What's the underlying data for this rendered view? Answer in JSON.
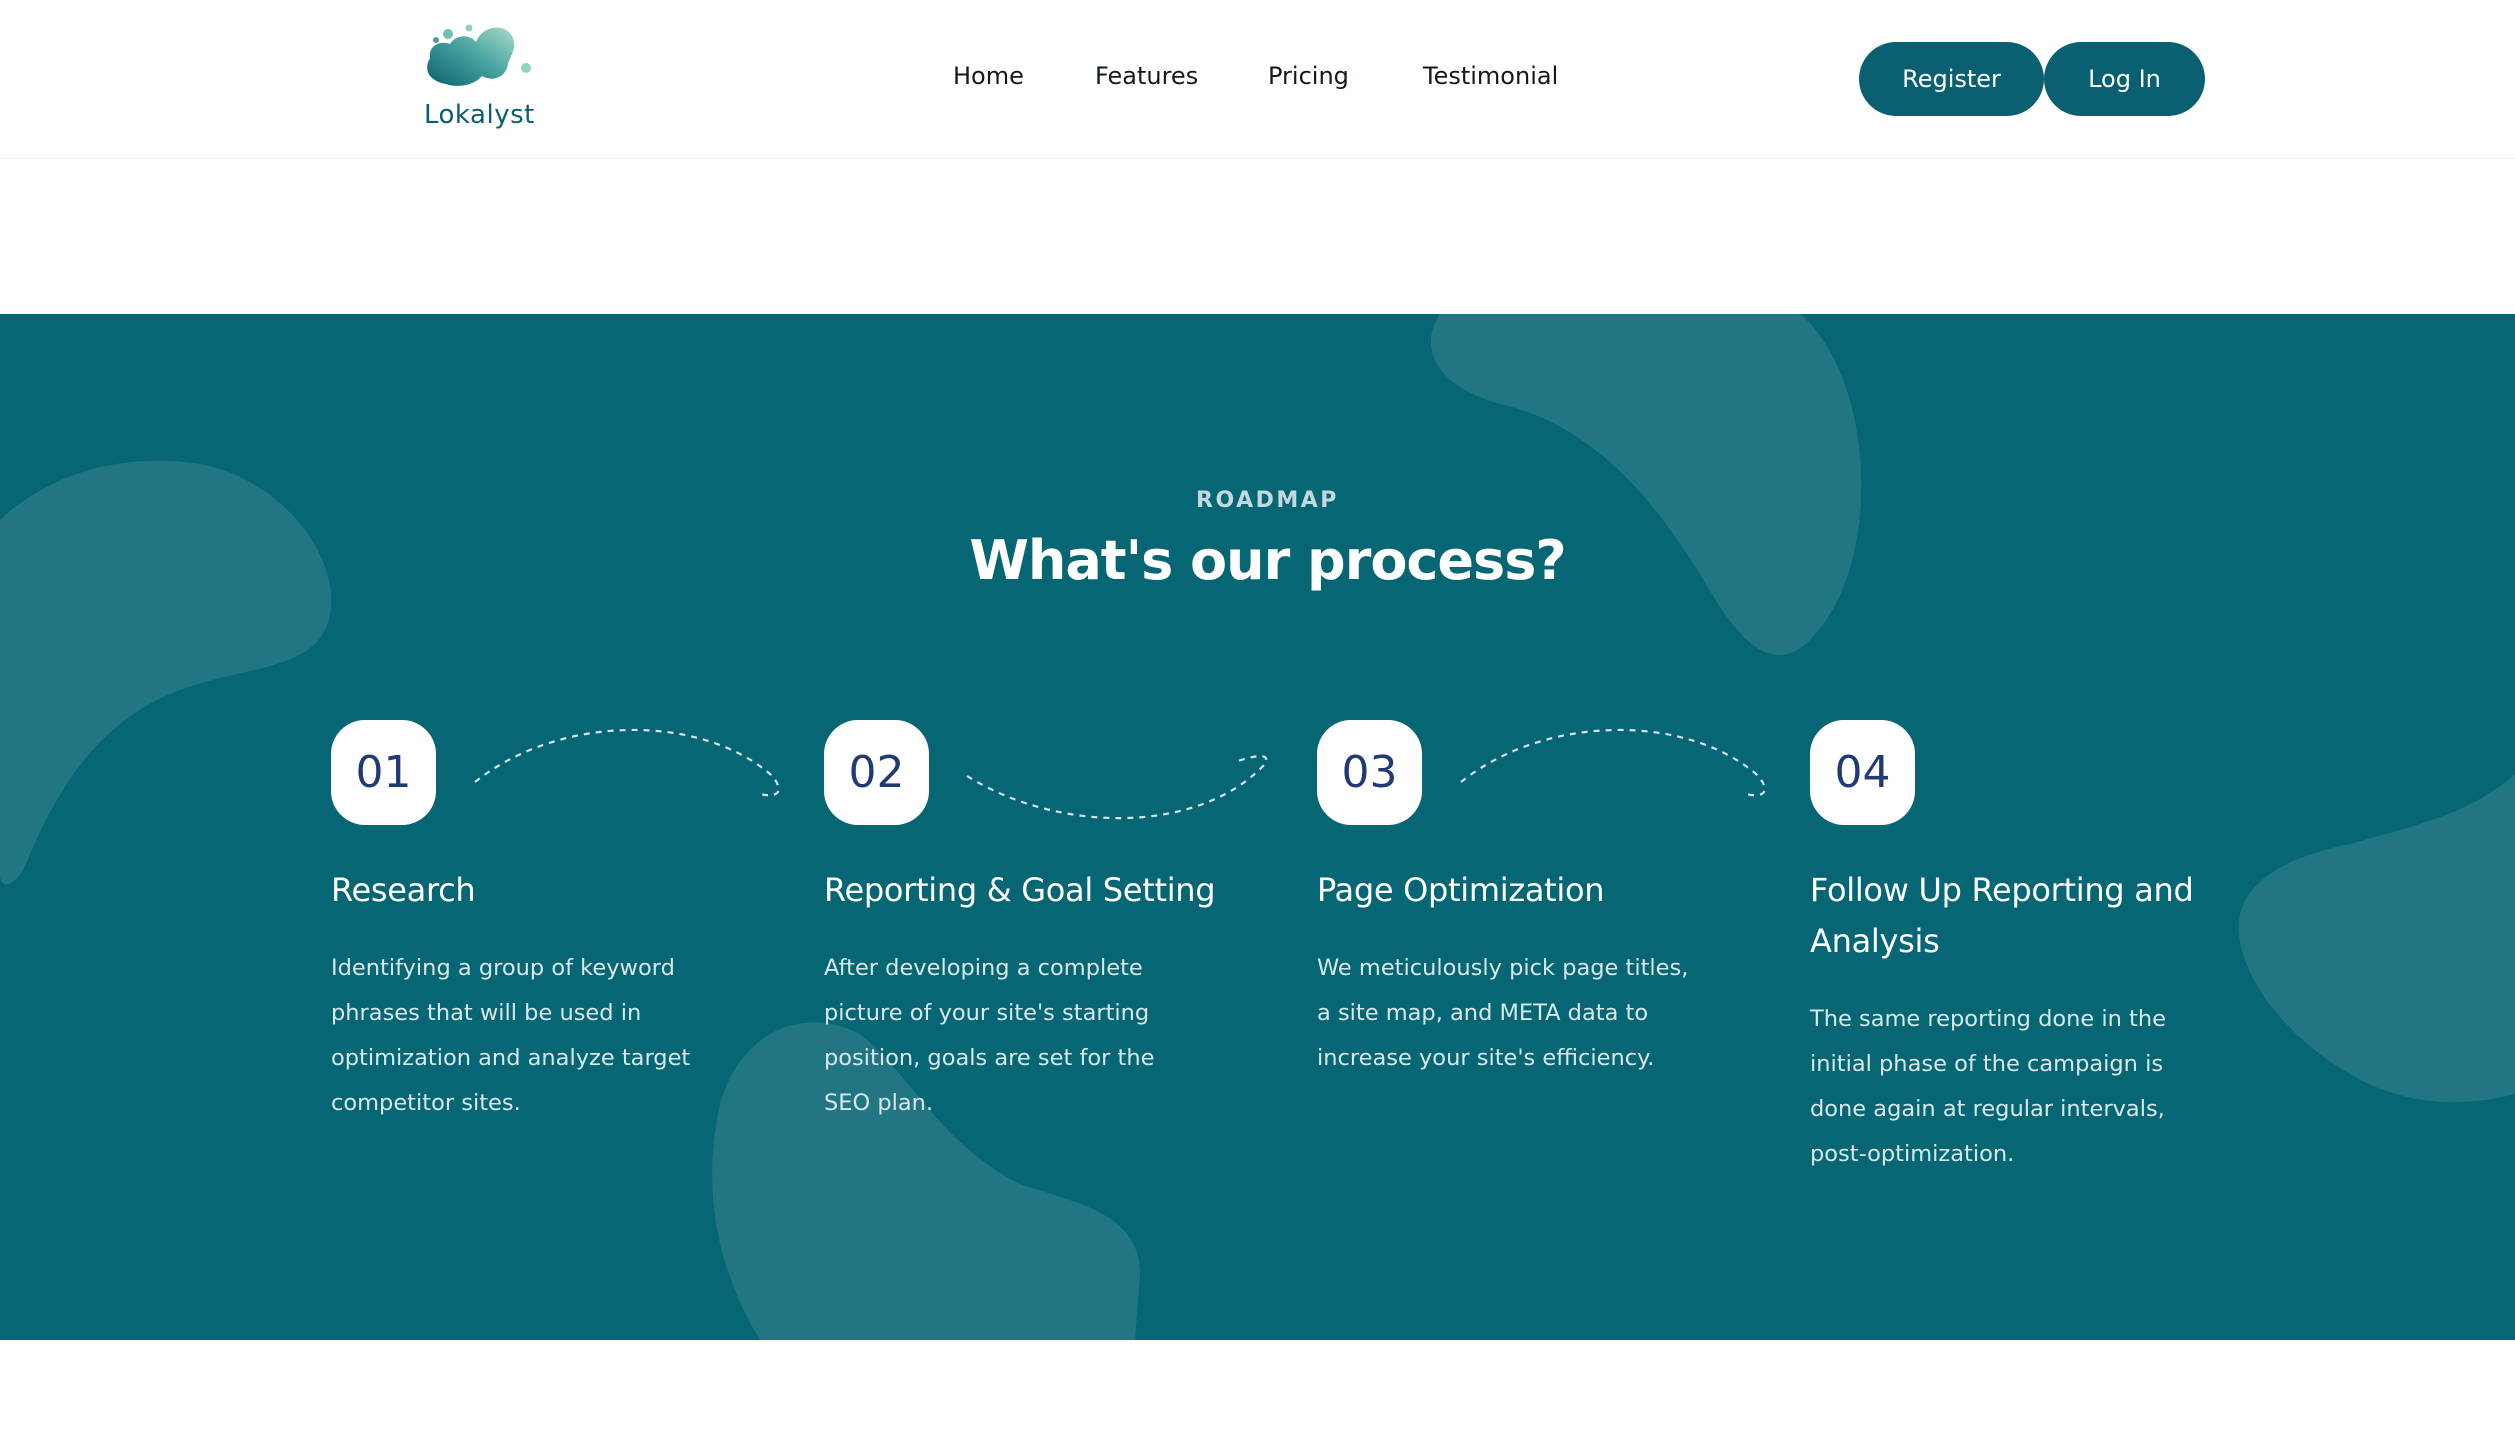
{
  "brand": {
    "name": "Lokalyst",
    "colors": {
      "primary": "#0a5f70",
      "section_bg": "#076674",
      "number_text": "#223a74"
    }
  },
  "nav": {
    "items": [
      {
        "label": "Home"
      },
      {
        "label": "Features"
      },
      {
        "label": "Pricing"
      },
      {
        "label": "Testimonial"
      }
    ]
  },
  "actions": {
    "register_label": "Register",
    "login_label": "Log In"
  },
  "roadmap": {
    "eyebrow": "ROADMAP",
    "title": "What's our process?",
    "steps": [
      {
        "number": "01",
        "title": "Research",
        "description": "Identifying a group of keyword phrases that will be used in optimization and analyze target competitor sites."
      },
      {
        "number": "02",
        "title": "Reporting & Goal Setting",
        "description": "After developing a complete picture of your site's starting position, goals are set for the SEO plan."
      },
      {
        "number": "03",
        "title": "Page Optimization",
        "description": "We meticulously pick page titles, a site map, and META data to increase your site's efficiency."
      },
      {
        "number": "04",
        "title": "Follow Up Reporting and Analysis",
        "description": "The same reporting done in the initial phase of the campaign is done again at regular intervals, post-optimization."
      }
    ]
  }
}
